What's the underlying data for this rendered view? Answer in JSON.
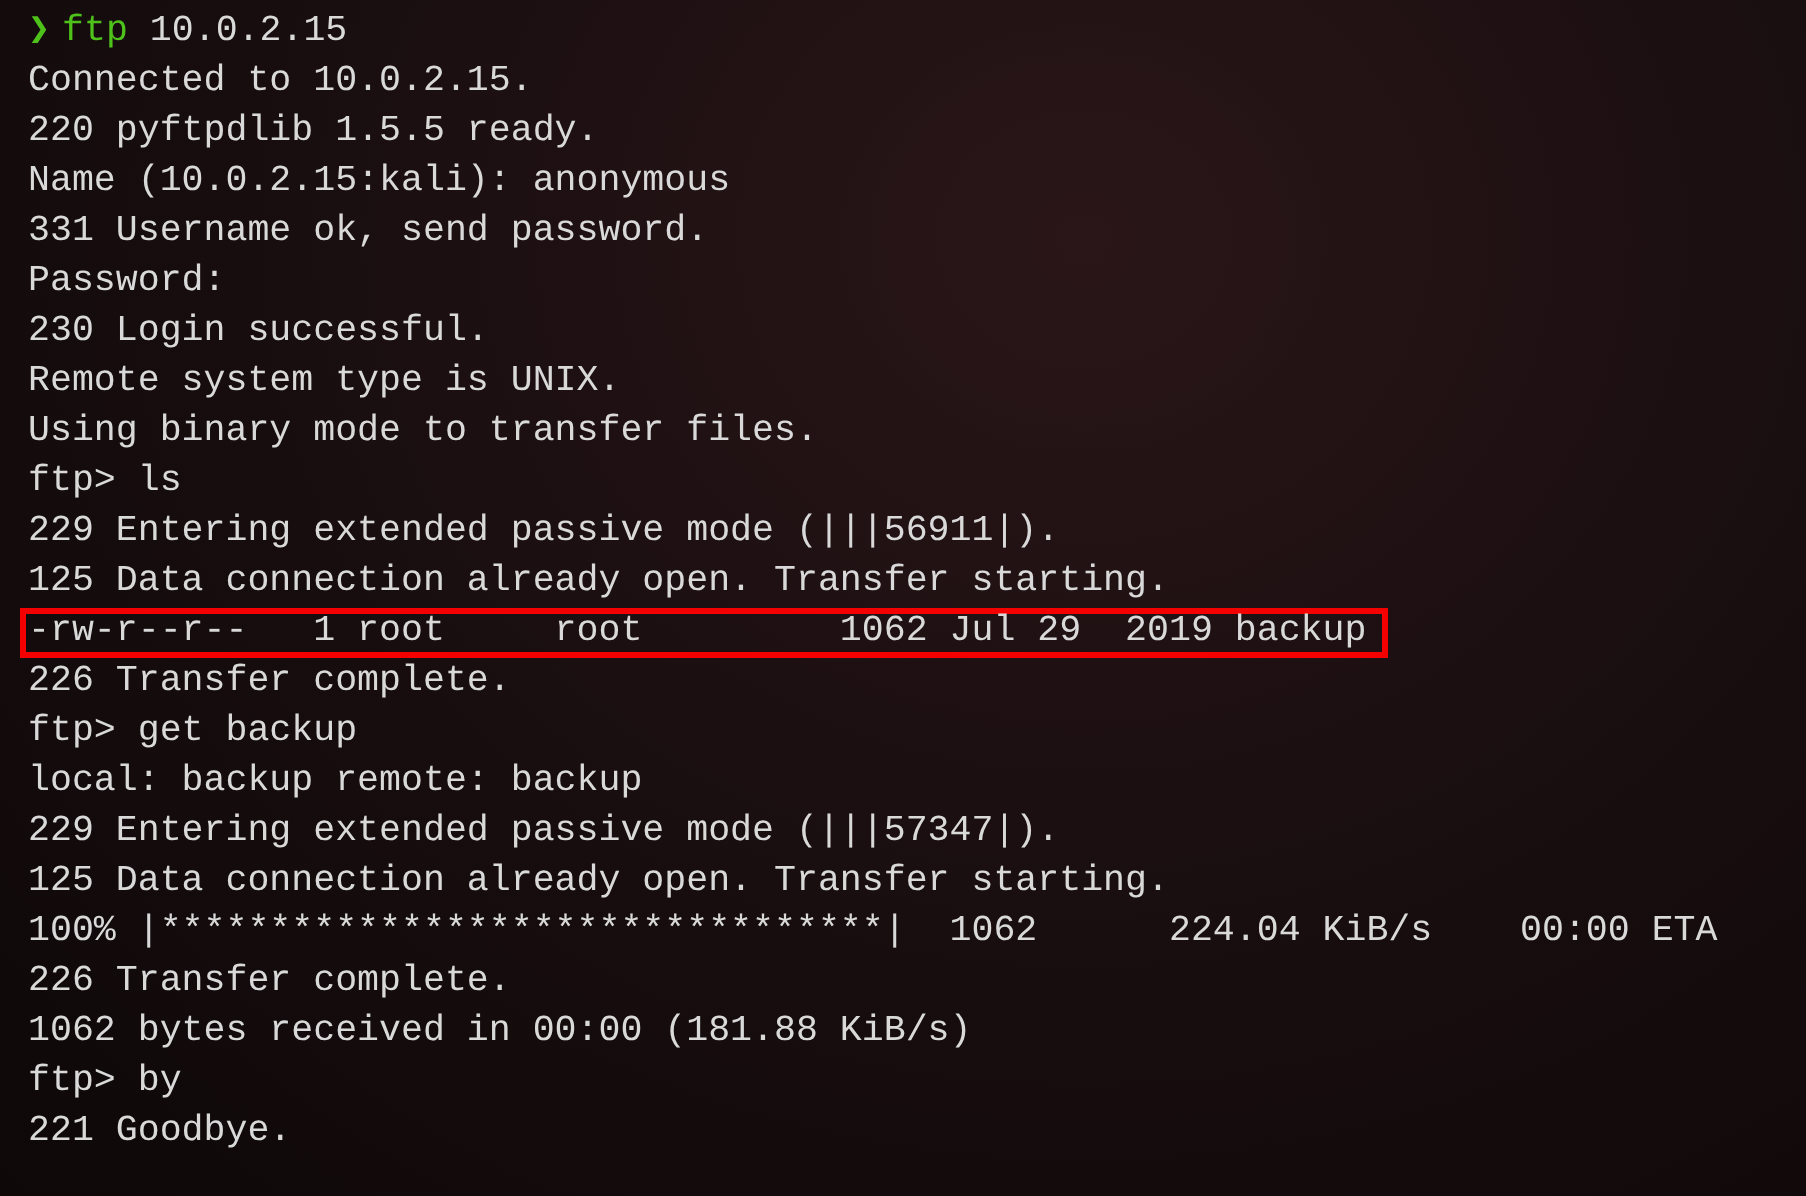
{
  "prompt": {
    "symbol": "❯",
    "command": "ftp",
    "args": "10.0.2.15"
  },
  "lines": [
    {
      "text": "Connected to 10.0.2.15.",
      "highlighted": false
    },
    {
      "text": "220 pyftpdlib 1.5.5 ready.",
      "highlighted": false
    },
    {
      "text": "Name (10.0.2.15:kali): anonymous",
      "highlighted": false
    },
    {
      "text": "331 Username ok, send password.",
      "highlighted": false
    },
    {
      "text": "Password:",
      "highlighted": false
    },
    {
      "text": "230 Login successful.",
      "highlighted": false
    },
    {
      "text": "Remote system type is UNIX.",
      "highlighted": false
    },
    {
      "text": "Using binary mode to transfer files.",
      "highlighted": false
    },
    {
      "text": "ftp> ls",
      "highlighted": false
    },
    {
      "text": "229 Entering extended passive mode (|||56911|).",
      "highlighted": false
    },
    {
      "text": "125 Data connection already open. Transfer starting.",
      "highlighted": false
    },
    {
      "text": "-rw-r--r--   1 root     root         1062 Jul 29  2019 backup",
      "highlighted": true
    },
    {
      "text": "226 Transfer complete.",
      "highlighted": false
    },
    {
      "text": "ftp> get backup",
      "highlighted": false
    },
    {
      "text": "local: backup remote: backup",
      "highlighted": false
    },
    {
      "text": "229 Entering extended passive mode (|||57347|).",
      "highlighted": false
    },
    {
      "text": "125 Data connection already open. Transfer starting.",
      "highlighted": false
    },
    {
      "text": "100% |*********************************|  1062      224.04 KiB/s    00:00 ETA",
      "highlighted": false
    },
    {
      "text": "226 Transfer complete.",
      "highlighted": false
    },
    {
      "text": "1062 bytes received in 00:00 (181.88 KiB/s)",
      "highlighted": false
    },
    {
      "text": "ftp> by",
      "highlighted": false
    },
    {
      "text": "221 Goodbye.",
      "highlighted": false
    }
  ]
}
